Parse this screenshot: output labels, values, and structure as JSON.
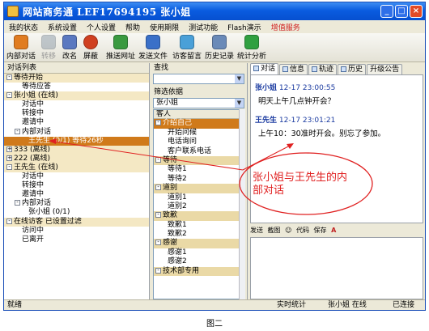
{
  "window": {
    "title": "网站商务通   LEF17694195  张小姐",
    "controls": [
      "_",
      "□",
      "×"
    ]
  },
  "menu": [
    "我的状态",
    "系统设置",
    "个人设置",
    "帮助",
    "使用期限",
    "测试功能",
    "Flash演示",
    "增值服务"
  ],
  "toolbar": [
    {
      "label": "内部对话",
      "icon": "chat-icon",
      "color": "#e07c20",
      "enabled": true
    },
    {
      "label": "转移",
      "icon": "transfer-icon",
      "color": "#8090a0",
      "enabled": false
    },
    {
      "label": "改名",
      "icon": "rename-icon",
      "color": "#5a78c0",
      "enabled": true
    },
    {
      "label": "屏蔽",
      "icon": "block-icon",
      "color": "#d04020",
      "enabled": true
    },
    {
      "label": "推送网址",
      "icon": "push-url-icon",
      "color": "#3a9a40",
      "enabled": true
    },
    {
      "label": "发送文件",
      "icon": "send-file-icon",
      "color": "#3a70c8",
      "enabled": true
    },
    {
      "label": "访客留言",
      "icon": "guest-message-icon",
      "color": "#4aa0d8",
      "enabled": true
    },
    {
      "label": "历史记录",
      "icon": "history-icon",
      "color": "#6a8ab8",
      "enabled": true
    },
    {
      "label": "统计分析",
      "icon": "statistics-icon",
      "color": "#30a040",
      "enabled": true
    }
  ],
  "left_panel": {
    "title": "对话列表",
    "rows": [
      {
        "text": "等待开始",
        "level": "l0",
        "style": "group",
        "toggle": "-"
      },
      {
        "text": "等待应答",
        "level": "l1",
        "style": "plain",
        "toggle": ""
      },
      {
        "text": "张小姐 (在线)",
        "level": "l0",
        "style": "group",
        "toggle": "-"
      },
      {
        "text": "对话中",
        "level": "l1",
        "style": "plain",
        "toggle": ""
      },
      {
        "text": "转接中",
        "level": "l1",
        "style": "plain",
        "toggle": ""
      },
      {
        "text": "邀请中",
        "level": "l1",
        "style": "plain",
        "toggle": ""
      },
      {
        "text": "内部对话",
        "level": "l1b",
        "style": "plain",
        "toggle": "-"
      },
      {
        "text": "王先生 (0/1) 等待26秒",
        "level": "l2",
        "style": "selected",
        "toggle": ""
      },
      {
        "text": "333 (离线)",
        "level": "l0",
        "style": "group",
        "toggle": "+"
      },
      {
        "text": "222 (离线)",
        "level": "l0",
        "style": "group",
        "toggle": "+"
      },
      {
        "text": "王先生 (在线)",
        "level": "l0",
        "style": "group",
        "toggle": "-"
      },
      {
        "text": "对话中",
        "level": "l1",
        "style": "plain",
        "toggle": ""
      },
      {
        "text": "转接中",
        "level": "l1",
        "style": "plain",
        "toggle": ""
      },
      {
        "text": "邀请中",
        "level": "l1",
        "style": "plain",
        "toggle": ""
      },
      {
        "text": "内部对话",
        "level": "l1b",
        "style": "plain",
        "toggle": "-"
      },
      {
        "text": "张小姐 (0/1)",
        "level": "l2",
        "style": "plain",
        "toggle": ""
      },
      {
        "text": "在线访客 已设置过滤",
        "level": "l0",
        "style": "group",
        "toggle": "-"
      },
      {
        "text": "访问中",
        "level": "l1",
        "style": "plain",
        "toggle": ""
      },
      {
        "text": "已离开",
        "level": "l1",
        "style": "plain",
        "toggle": ""
      }
    ]
  },
  "middle_panel": {
    "search_label": "查找",
    "search_value": "",
    "filter_label": "筛选依据",
    "filter_value": "张小姐",
    "list_header": "客人",
    "rows": [
      {
        "text": "介绍自己",
        "style": "cat-sel",
        "toggle": "-"
      },
      {
        "text": "开始问候",
        "style": "item",
        "toggle": ""
      },
      {
        "text": "电话询问",
        "style": "item",
        "toggle": ""
      },
      {
        "text": "客户联系电话",
        "style": "item",
        "toggle": ""
      },
      {
        "text": "等待",
        "style": "cat",
        "toggle": "-"
      },
      {
        "text": "等待1",
        "style": "item",
        "toggle": ""
      },
      {
        "text": "等待2",
        "style": "item",
        "toggle": ""
      },
      {
        "text": "道别",
        "style": "cat",
        "toggle": "-"
      },
      {
        "text": "道别1",
        "style": "item",
        "toggle": ""
      },
      {
        "text": "道别2",
        "style": "item",
        "toggle": ""
      },
      {
        "text": "致歉",
        "style": "cat",
        "toggle": "-"
      },
      {
        "text": "致歉1",
        "style": "item",
        "toggle": ""
      },
      {
        "text": "致歉2",
        "style": "item",
        "toggle": ""
      },
      {
        "text": "感谢",
        "style": "cat",
        "toggle": "-"
      },
      {
        "text": "感谢1",
        "style": "item",
        "toggle": ""
      },
      {
        "text": "感谢2",
        "style": "item",
        "toggle": ""
      },
      {
        "text": "技术部专用",
        "style": "cat",
        "toggle": "-"
      }
    ]
  },
  "right_panel": {
    "tabs": [
      "对话",
      "信息",
      "轨迹",
      "历史",
      "升级公告"
    ],
    "messages": [
      {
        "sender": "张小姐",
        "time": "12-17 23:00:55",
        "text": "明天上午几点钟开会？"
      },
      {
        "sender": "王先生",
        "time": "12-17 23:01:21",
        "text": "上午10：30准时开会。别忘了参加。"
      }
    ],
    "format_bar": [
      "发送",
      "截图",
      "代码",
      "保存",
      "A"
    ]
  },
  "annotation": {
    "text_line1": "张小姐与王先生的内",
    "text_line2": "部对话",
    "color": "#e02020"
  },
  "statusbar": {
    "left": "就绪",
    "stats": "实时统计",
    "user": "张小姐 在线",
    "connection": "已连接"
  },
  "caption": "图二"
}
